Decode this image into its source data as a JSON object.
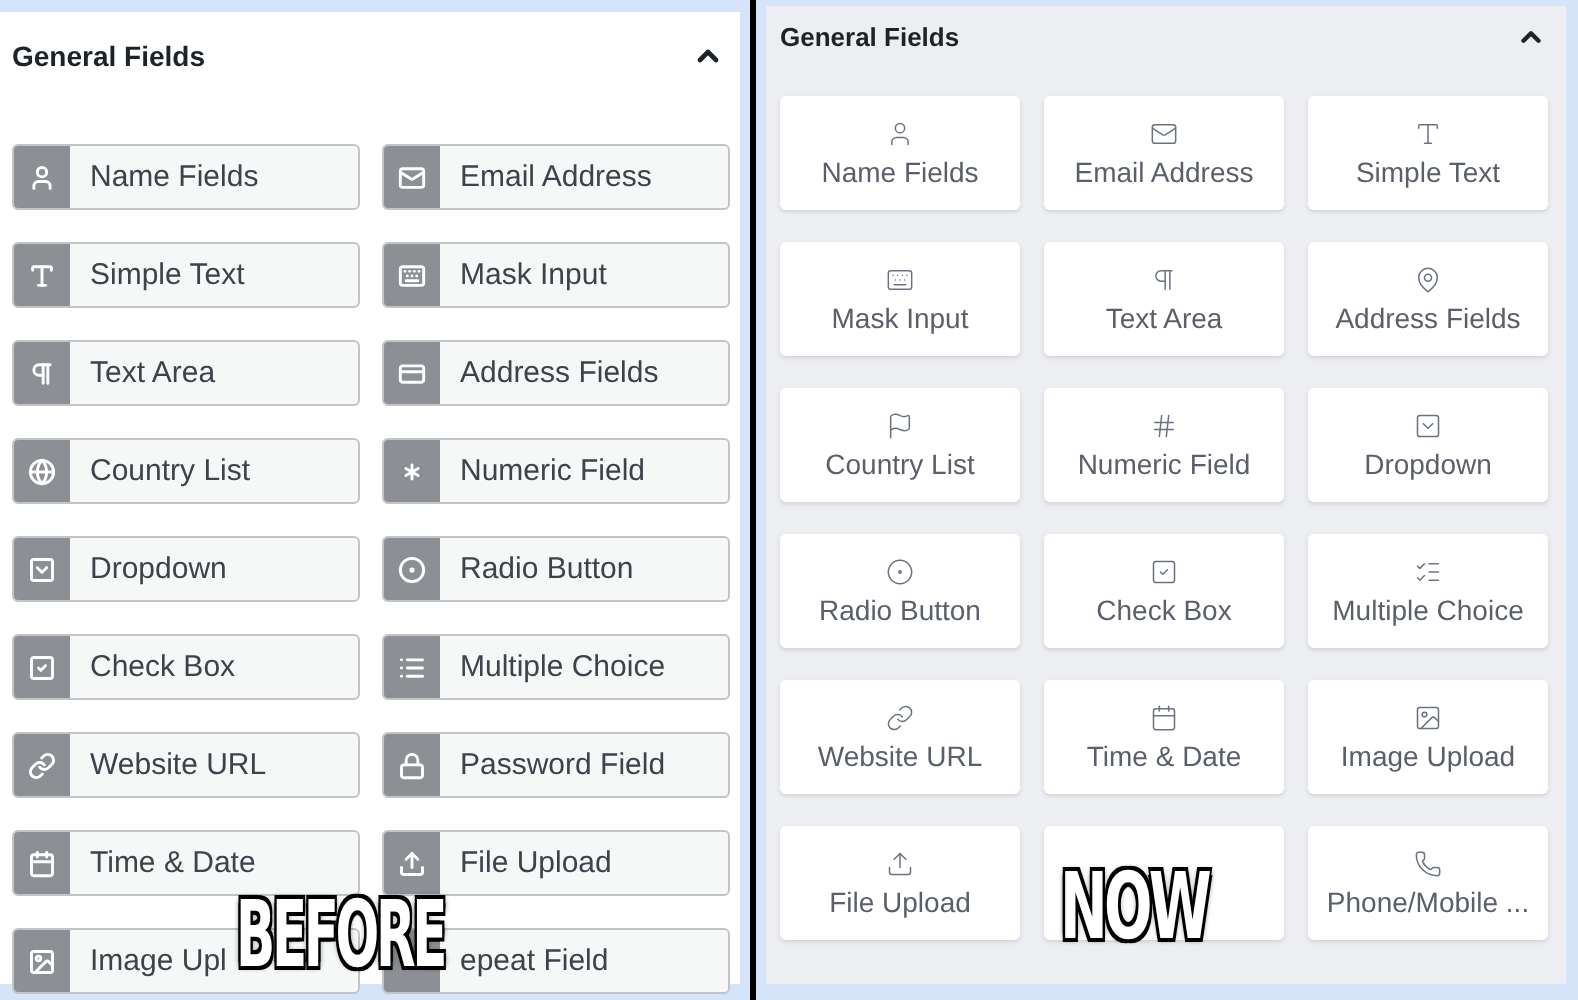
{
  "before_panel": {
    "title": "General Fields",
    "fields": [
      {
        "label": "Name Fields"
      },
      {
        "label": "Email Address"
      },
      {
        "label": "Simple Text"
      },
      {
        "label": "Mask Input"
      },
      {
        "label": "Text Area"
      },
      {
        "label": "Address Fields"
      },
      {
        "label": "Country List"
      },
      {
        "label": "Numeric Field"
      },
      {
        "label": "Dropdown"
      },
      {
        "label": "Radio Button"
      },
      {
        "label": "Check Box"
      },
      {
        "label": "Multiple Choice"
      },
      {
        "label": "Website URL"
      },
      {
        "label": "Password Field"
      },
      {
        "label": "Time & Date"
      },
      {
        "label": "File Upload"
      },
      {
        "label": "Image Upl"
      },
      {
        "label": "epeat Field"
      }
    ],
    "caption": "BEFORE"
  },
  "now_panel": {
    "title": "General Fields",
    "fields": [
      {
        "kind": "field",
        "label": "Name Fields"
      },
      {
        "kind": "field",
        "label": "Email Address"
      },
      {
        "kind": "field",
        "label": "Simple Text"
      },
      {
        "kind": "field",
        "label": "Mask Input"
      },
      {
        "kind": "field",
        "label": "Text Area"
      },
      {
        "kind": "field",
        "label": "Address Fields"
      },
      {
        "kind": "field",
        "label": "Country List"
      },
      {
        "kind": "field",
        "label": "Numeric Field"
      },
      {
        "kind": "field",
        "label": "Dropdown"
      },
      {
        "kind": "field",
        "label": "Radio Button"
      },
      {
        "kind": "field",
        "label": "Check Box"
      },
      {
        "kind": "field",
        "label": "Multiple Choice"
      },
      {
        "kind": "field",
        "label": "Website URL"
      },
      {
        "kind": "field",
        "label": "Time & Date"
      },
      {
        "kind": "field",
        "label": "Image Upload"
      },
      {
        "kind": "field",
        "label": "File Upload"
      },
      {
        "kind": "blank"
      },
      {
        "kind": "field",
        "label": "Phone/Mobile ..."
      }
    ],
    "caption": "NOW"
  }
}
